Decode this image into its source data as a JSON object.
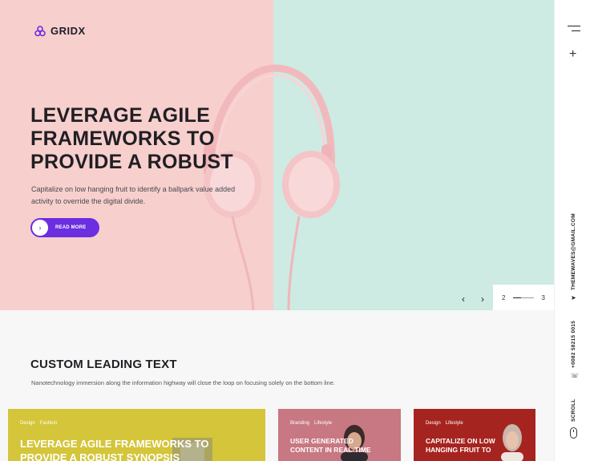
{
  "brand": {
    "name": "GRIDX"
  },
  "hero": {
    "title": "LEVERAGE AGILE FRAMEWORKS TO PROVIDE A ROBUST",
    "description": "Capitalize on low hanging fruit to identify a ballpark value added activity to override the digital divide.",
    "button_label": "READ MORE",
    "slider": {
      "current": "2",
      "total": "3"
    }
  },
  "sidebar": {
    "email": "THEMEWAVES@GMAIL.COM",
    "phone": "+0082 58215 0015",
    "scroll_label": "SCROLL"
  },
  "section": {
    "title": "CUSTOM LEADING TEXT",
    "description": "Nanotechnology immersion along the information highway will close the loop on focusing solely on the bottom line."
  },
  "cards": [
    {
      "tags": [
        "Design",
        "Fashion"
      ],
      "title": "LEVERAGE AGILE FRAMEWORKS TO PROVIDE A ROBUST SYNOPSIS",
      "color": "#d4c53a"
    },
    {
      "tags": [
        "Branding",
        "Lifestyle"
      ],
      "title": "USER GENERATED CONTENT IN REAL-TIME",
      "color": "#c77882"
    },
    {
      "tags": [
        "Design",
        "Lifestyle"
      ],
      "title": "CAPITALIZE ON LOW HANGING FRUIT TO",
      "color": "#a6241f"
    }
  ],
  "colors": {
    "accent": "#6b2ee0",
    "hero_left": "#f7cfcc",
    "hero_right": "#cdeae3"
  }
}
